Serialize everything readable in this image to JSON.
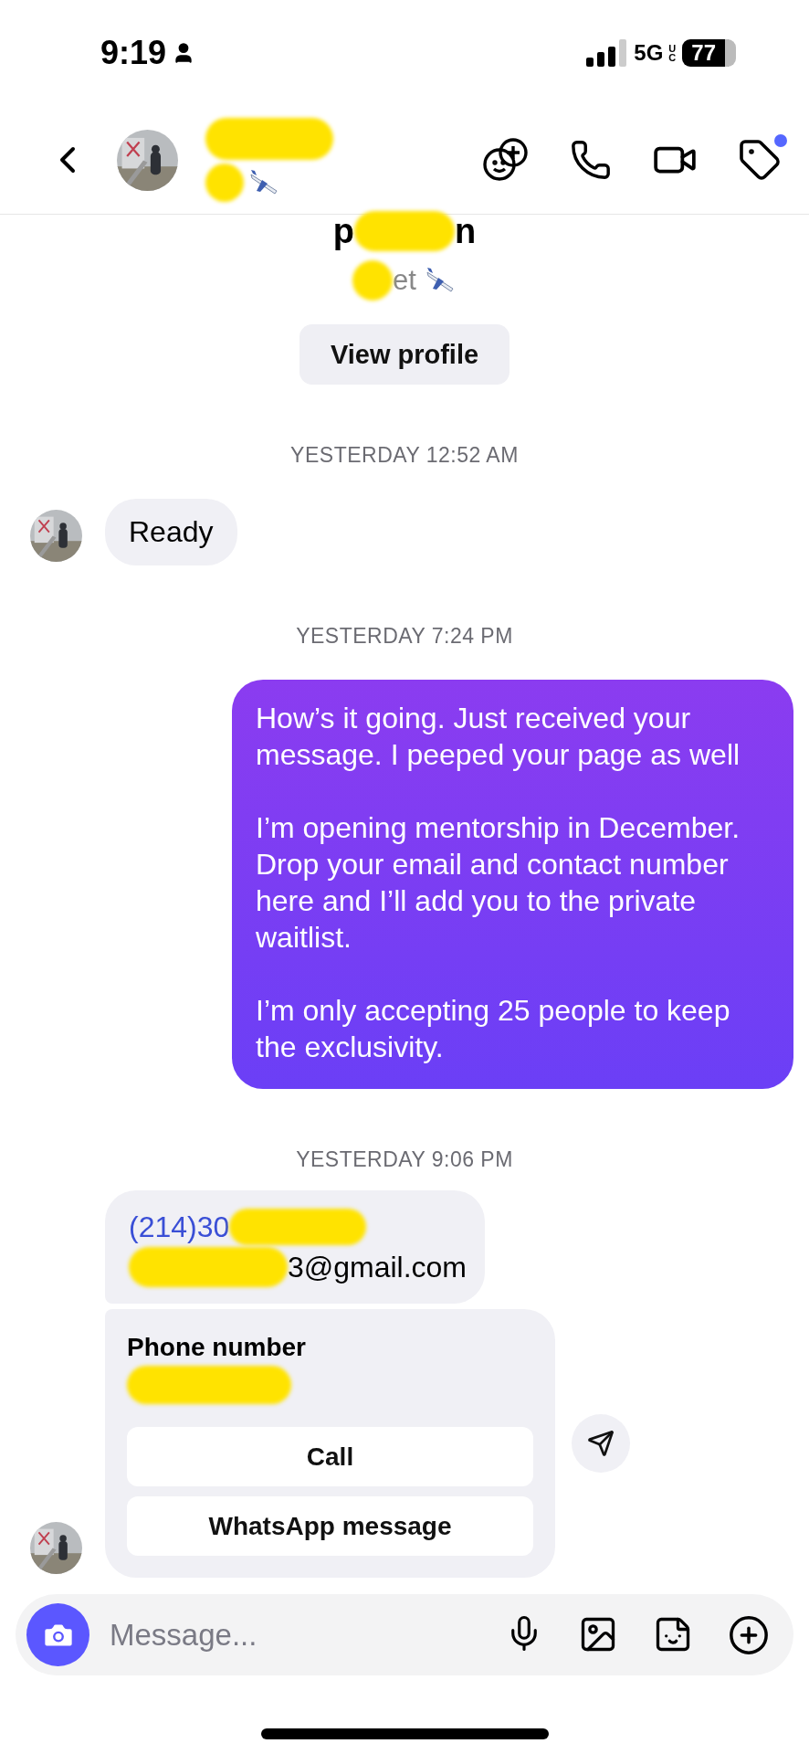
{
  "status_bar": {
    "time": "9:19",
    "network": "5G",
    "network_sub": "UC",
    "battery": "77"
  },
  "header": {
    "has_unread_dot": true
  },
  "profile": {
    "name_start": "p",
    "name_end": "n",
    "subtitle": "et",
    "button": "View profile"
  },
  "messages": [
    {
      "kind": "timestamp",
      "text": "YESTERDAY 12:52 AM"
    },
    {
      "kind": "incoming",
      "show_avatar": true,
      "text": "Ready"
    },
    {
      "kind": "timestamp",
      "text": "YESTERDAY 7:24 PM"
    },
    {
      "kind": "outgoing",
      "paragraphs": [
        "How’s it going. Just received your message. I peeped your page as well",
        "I’m opening mentorship in December. Drop your email and contact number here and I’ll add you to the private waitlist.",
        "I’m only accepting 25 people to keep the exclusivity."
      ]
    },
    {
      "kind": "timestamp",
      "text": "YESTERDAY 9:06 PM"
    },
    {
      "kind": "contact",
      "show_avatar": true,
      "phone_prefix": "(214)30",
      "email_suffix": "3@gmail.com",
      "card_title": "Phone number",
      "actions": [
        "Call",
        "WhatsApp message"
      ]
    }
  ],
  "composer": {
    "placeholder": "Message..."
  }
}
